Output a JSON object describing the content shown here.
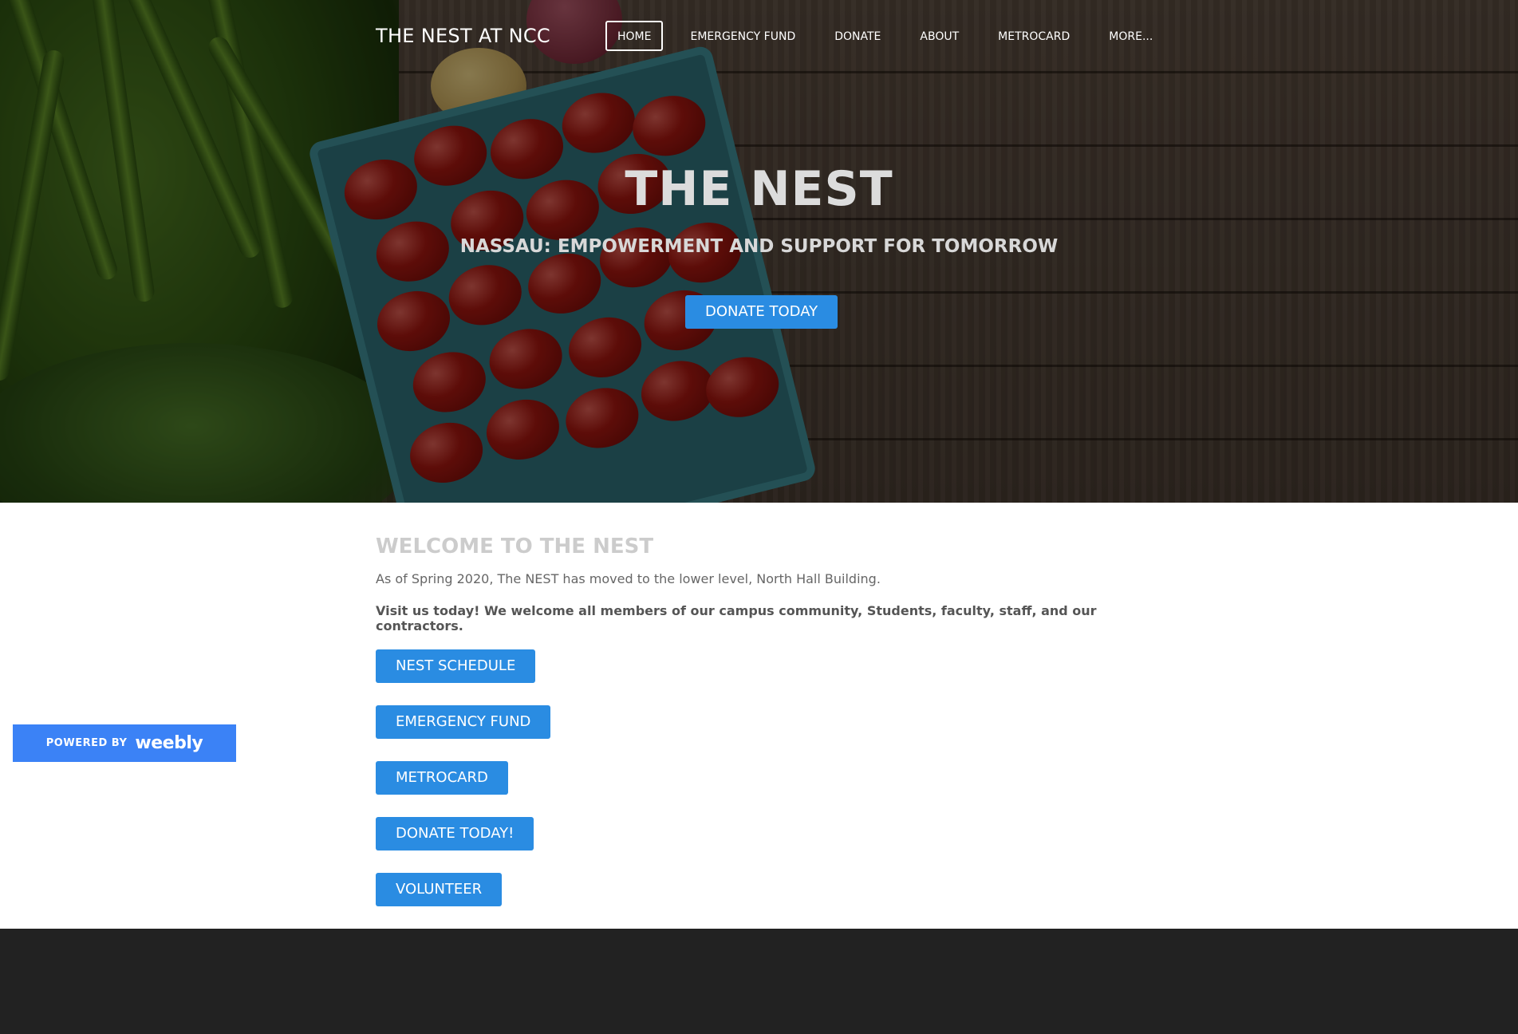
{
  "header": {
    "site_title": "THE NEST AT NCC",
    "nav": [
      {
        "label": "HOME",
        "active": true
      },
      {
        "label": "EMERGENCY FUND",
        "active": false
      },
      {
        "label": "DONATE",
        "active": false
      },
      {
        "label": "ABOUT",
        "active": false
      },
      {
        "label": "METROCARD",
        "active": false
      },
      {
        "label": "MORE...",
        "active": false
      }
    ]
  },
  "hero": {
    "title": "THE NEST",
    "subtitle": "NASSAU: EMPOWERMENT AND SUPPORT FOR TOMORROW",
    "button_label": "DONATE TODAY"
  },
  "main": {
    "heading": "WELCOME TO THE NEST",
    "paragraph1": "As of Spring 2020, The NEST has moved to the lower level, North Hall Building.",
    "paragraph2": "Visit us today! We welcome all members of our campus community, Students, faculty, staff, and our contractors.",
    "buttons": [
      {
        "label": "NEST SCHEDULE"
      },
      {
        "label": "EMERGENCY FUND"
      },
      {
        "label": "METROCARD"
      },
      {
        "label": "DONATE TODAY!"
      },
      {
        "label": "VOLUNTEER"
      }
    ]
  },
  "badge": {
    "powered_by": "POWERED BY",
    "brand": "weebly"
  },
  "colors": {
    "accent": "#2a8ce2",
    "weebly_blue": "#3b82f6",
    "footer": "#222222"
  }
}
